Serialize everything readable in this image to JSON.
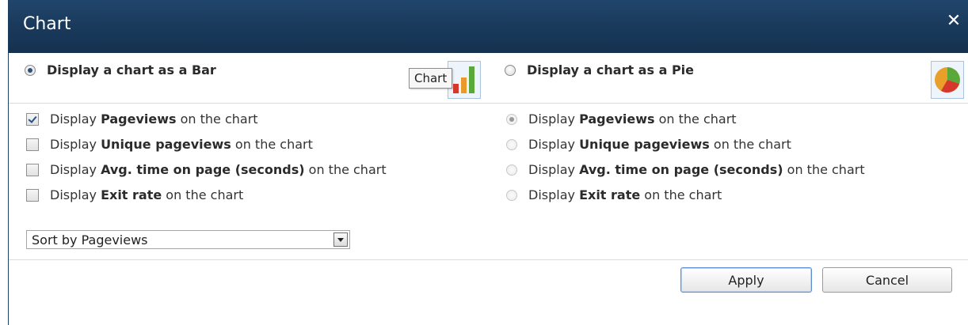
{
  "dialog": {
    "title": "Chart",
    "close_label": "✕"
  },
  "bar_option": {
    "label": "Display a chart as a Bar",
    "selected": true,
    "tooltip": "Chart"
  },
  "pie_option": {
    "label": "Display a chart as a Pie",
    "selected": false
  },
  "bar_metrics": [
    {
      "pre": "Display ",
      "bold": "Pageviews",
      "post": " on the chart",
      "checked": true
    },
    {
      "pre": "Display ",
      "bold": "Unique pageviews",
      "post": " on the chart",
      "checked": false
    },
    {
      "pre": "Display ",
      "bold": "Avg. time on page (seconds)",
      "post": " on the chart",
      "checked": false
    },
    {
      "pre": "Display ",
      "bold": "Exit rate",
      "post": " on the chart",
      "checked": false
    }
  ],
  "pie_metrics": [
    {
      "pre": "Display ",
      "bold": "Pageviews",
      "post": " on the chart",
      "selected": true
    },
    {
      "pre": "Display ",
      "bold": "Unique pageviews",
      "post": " on the chart",
      "selected": false
    },
    {
      "pre": "Display ",
      "bold": "Avg. time on page (seconds)",
      "post": " on the chart",
      "selected": false
    },
    {
      "pre": "Display ",
      "bold": "Exit rate",
      "post": " on the chart",
      "selected": false
    }
  ],
  "sort": {
    "value": "Sort by Pageviews"
  },
  "buttons": {
    "apply": "Apply",
    "cancel": "Cancel"
  },
  "colors": {
    "title_bar": "#1a3a5c",
    "accent": "#5c8fd0"
  }
}
